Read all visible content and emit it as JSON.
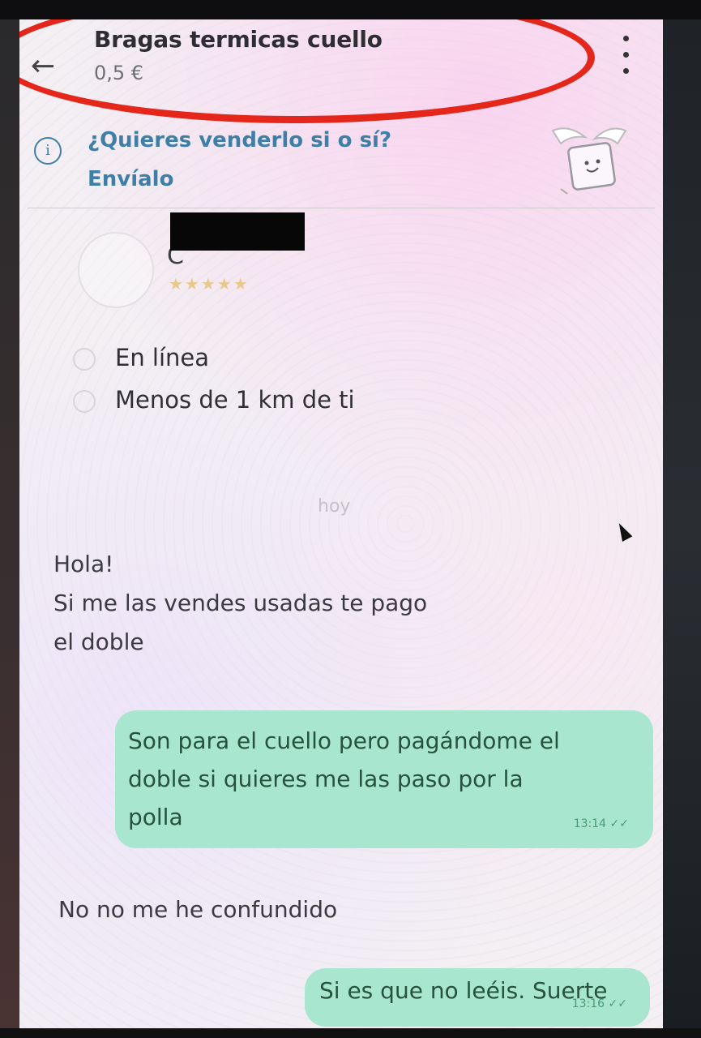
{
  "header": {
    "title": "Bragas termicas cuello",
    "price": "0,5 €"
  },
  "tip": {
    "text": "¿Quieres venderlo si o sí? Envíalo"
  },
  "profile": {
    "name": "C",
    "rating_stars": "★★★★★",
    "online": "En línea",
    "distance": "Menos de 1 km de ti"
  },
  "chat": {
    "date_separator": "hoy",
    "messages": [
      {
        "from": "buyer",
        "lines": [
          "Hola!",
          "Si me las vendes usadas te pago",
          "el doble"
        ]
      },
      {
        "from": "me",
        "lines": [
          "Son para el cuello pero pagándome el",
          "doble si quieres me las paso por la",
          "polla"
        ],
        "time": "13:14"
      },
      {
        "from": "buyer",
        "lines": [
          "No no me he confundido"
        ]
      },
      {
        "from": "me",
        "lines": [
          "Si es que no leéis. Suerte"
        ],
        "time": "13:16"
      }
    ]
  },
  "colors": {
    "annotation_red": "#e5261a",
    "outgoing_bubble": "#a9e6cf",
    "tip_blue": "#3f7ea6"
  }
}
